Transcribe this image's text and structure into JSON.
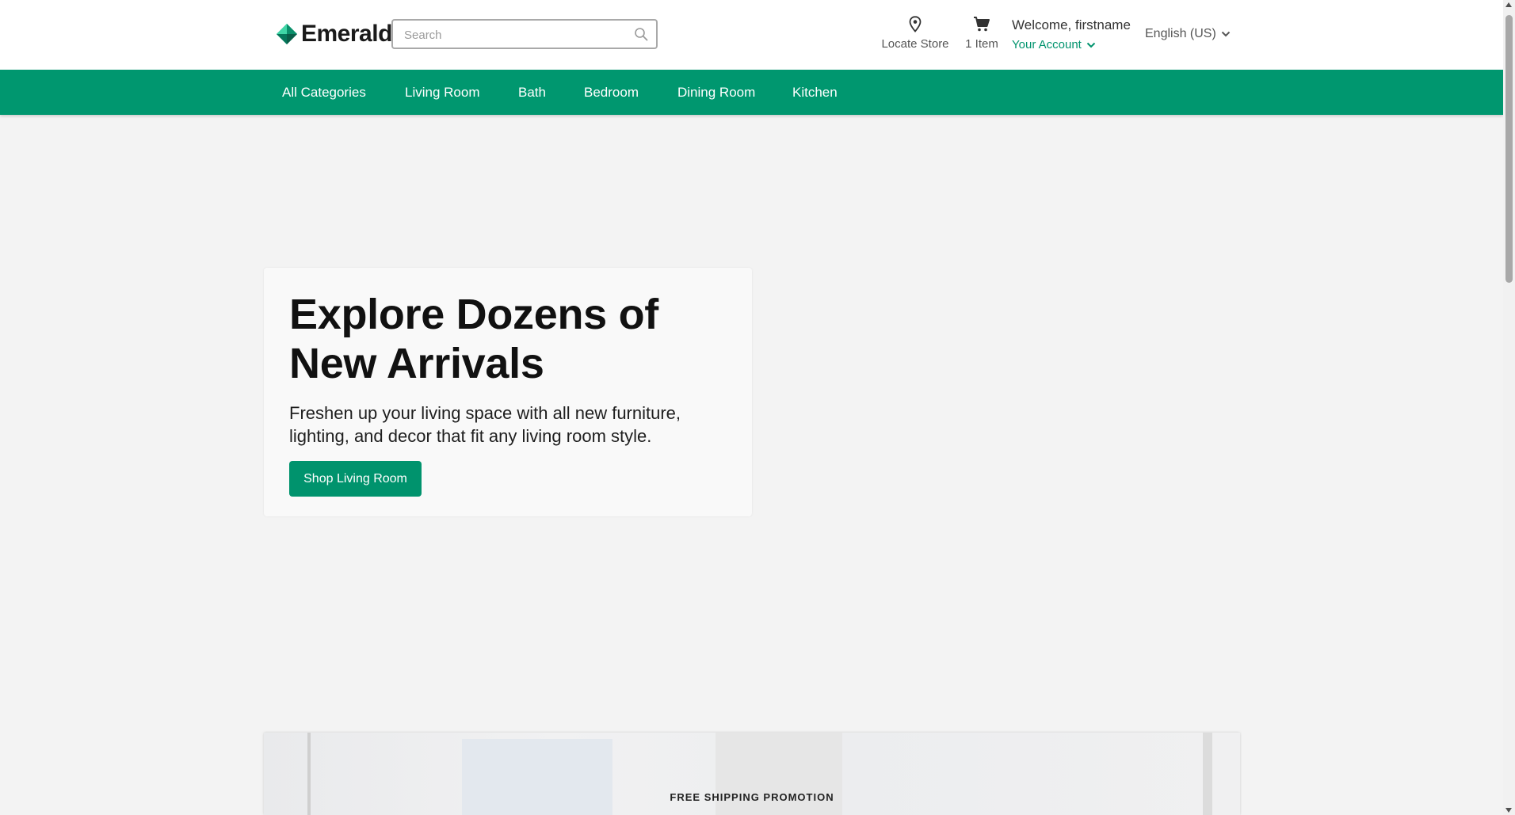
{
  "brand": {
    "name": "Emerald",
    "color": "#00936d"
  },
  "search": {
    "placeholder": "Search",
    "value": ""
  },
  "header": {
    "locate_label": "Locate Store",
    "cart_label": "1 Item",
    "welcome": "Welcome, firstname",
    "account_label": "Your Account",
    "language": "English (US)"
  },
  "nav": {
    "items": [
      {
        "label": "All Categories"
      },
      {
        "label": "Living Room"
      },
      {
        "label": "Bath"
      },
      {
        "label": "Bedroom"
      },
      {
        "label": "Dining Room"
      },
      {
        "label": "Kitchen"
      }
    ]
  },
  "hero": {
    "title": "Explore Dozens of New Arrivals",
    "description": "Freshen up your living space with all new furniture, lighting, and decor that fit any living room style.",
    "button_label": "Shop Living Room"
  },
  "promo": {
    "label": "FREE SHIPPING PROMOTION"
  },
  "icons": {
    "search": "search-icon",
    "locate": "location-pin-icon",
    "cart": "cart-icon",
    "account_chevron": "chevron-down-icon",
    "language_chevron": "chevron-down-icon"
  },
  "colors": {
    "nav_bg": "#00976f",
    "page_bg": "#f3f3f3",
    "header_bg": "#ffffff"
  }
}
